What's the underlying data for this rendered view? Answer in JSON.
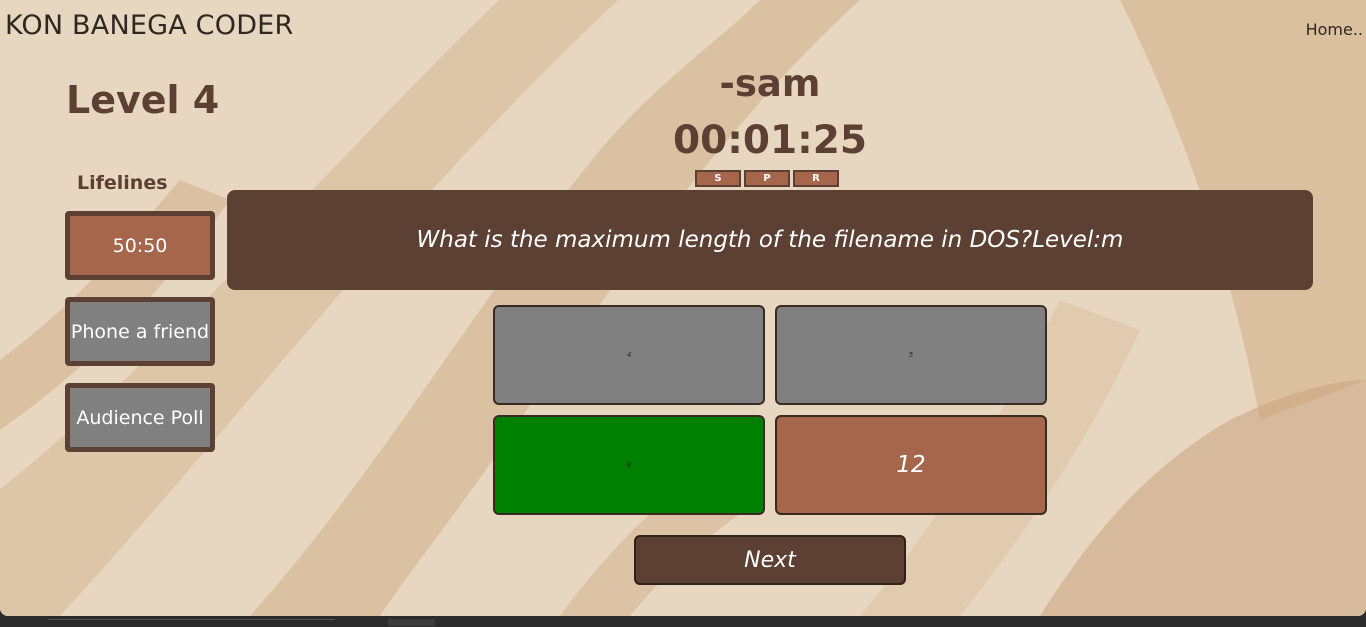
{
  "header": {
    "brand": "KON BANEGA CODER",
    "home_link": "Home.."
  },
  "game": {
    "level": "Level 4",
    "player": "-sam",
    "timer": "00:01:25"
  },
  "controls": {
    "s": "S",
    "p": "P",
    "r": "R"
  },
  "lifelines": {
    "label": "Lifelines",
    "fifty": "50:50",
    "phone": "Phone a friend",
    "poll": "Audience Poll"
  },
  "question": {
    "text": "What is the maximum length of the filename in DOS?Level:m"
  },
  "options": [
    "4",
    "5",
    "8",
    "12"
  ],
  "actions": {
    "next": "Next"
  },
  "colors": {
    "accent_dark": "#5c4033",
    "accent_light": "#a6664c",
    "correct": "#008000",
    "neutral": "#808080"
  }
}
